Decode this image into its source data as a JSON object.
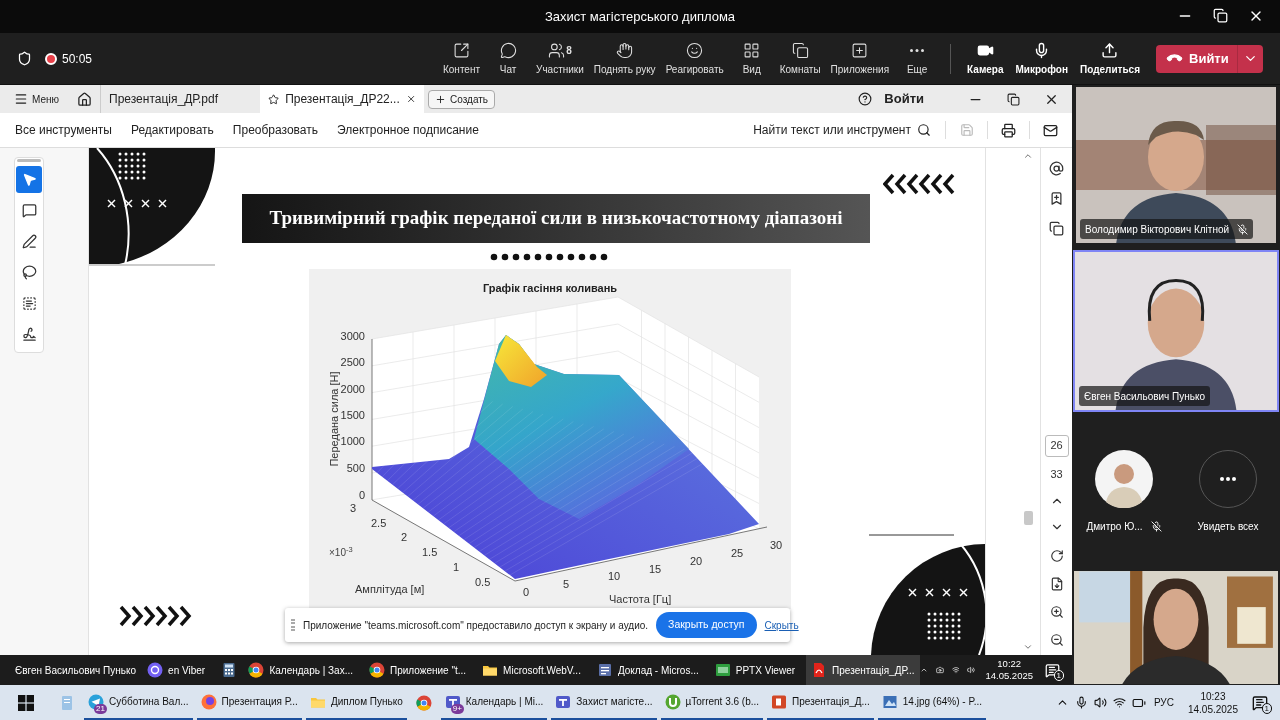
{
  "window": {
    "title": "Захист магістерського диплома"
  },
  "meeting": {
    "timer": "50:05",
    "recording": true,
    "actions": [
      {
        "label": "Контент"
      },
      {
        "label": "Чат"
      },
      {
        "label": "Участники",
        "count": "8"
      },
      {
        "label": "Поднять руку"
      },
      {
        "label": "Реагировать"
      },
      {
        "label": "Вид"
      },
      {
        "label": "Комнаты"
      },
      {
        "label": "Приложения"
      },
      {
        "label": "Еще"
      }
    ],
    "devices": [
      {
        "label": "Камера"
      },
      {
        "label": "Микрофон"
      },
      {
        "label": "Поделиться"
      }
    ],
    "leave_button": "Вийти"
  },
  "reader": {
    "menu_button": "Меню",
    "tabs": [
      {
        "label": "Презентація_ДР.pdf",
        "selected": false
      },
      {
        "label": "Презентація_ДР22...",
        "selected": true
      }
    ],
    "create_button": "Создать",
    "sign_in": "Войти",
    "menu": [
      "Все инструменты",
      "Редактировать",
      "Преобразовать",
      "Электронное подписание"
    ],
    "search": "Найти текст или инструмент",
    "tools": [
      {
        "selected": true
      },
      {
        "selected": false
      },
      {
        "selected": false
      },
      {
        "selected": false
      },
      {
        "selected": false
      },
      {
        "selected": false
      }
    ],
    "page": {
      "current": "26",
      "total": "33"
    }
  },
  "slide": {
    "title": "Тривимірний графік переданої сили в низькочастотному діапазоні",
    "chart": {
      "title": "Графік гасіння коливань",
      "zlabel": "Передана сила [Н]",
      "ylabel": "Амплітуда [м]",
      "xlabel": "Частота [Гц]",
      "yscale": "×10$^{-3}$",
      "zticks": [
        "3000",
        "2500",
        "2000",
        "1500",
        "1000",
        "500",
        "0"
      ],
      "yticks": [
        "3",
        "2.5",
        "2",
        "1.5",
        "1",
        "0.5"
      ],
      "xticks": [
        "0",
        "5",
        "10",
        "15",
        "20",
        "25",
        "30"
      ]
    }
  },
  "share_notice": {
    "text": "Приложение \"teams.microsoft.com\" предоставило доступ к экрану и аудио.",
    "button": "Закрыть доступ",
    "link": "Скрыть"
  },
  "participants": {
    "tiles": [
      {
        "name": "Володимир Вікторович Клітной",
        "muted": true,
        "speaking": false
      },
      {
        "name": "Євген Васильович Пунько",
        "muted": false,
        "speaking": true
      }
    ],
    "avatars": [
      {
        "name": "Дмитро Ю...",
        "muted": true
      }
    ],
    "see_all": "Увидеть всех"
  },
  "remote_taskbar": {
    "presenter": "Євген Васильович Пунько",
    "items": [
      {
        "kind": "window",
        "label": "en Viber"
      },
      {
        "kind": "pinned"
      },
      {
        "kind": "window",
        "label": "Календарь | Зах..."
      },
      {
        "kind": "window",
        "label": "Приложение \"t..."
      },
      {
        "kind": "window",
        "label": "Microsoft.WebV..."
      },
      {
        "kind": "window",
        "label": "Доклад - Micros..."
      },
      {
        "kind": "window",
        "label": "PPTX Viewer"
      },
      {
        "kind": "active",
        "label": "Презентація_ДР..."
      }
    ],
    "time": "10:22",
    "date": "14.05.2025",
    "notifications": "1"
  },
  "taskbar": {
    "items": [
      {
        "kind": "pinned"
      },
      {
        "kind": "window",
        "label": "Субботина Вал...",
        "badge": "21"
      },
      {
        "kind": "window",
        "label": "Презентация Р..."
      },
      {
        "kind": "window",
        "label": "Диплом Пунько"
      },
      {
        "kind": "pinned"
      },
      {
        "kind": "window",
        "label": "Календарь | Mi...",
        "badge": "9+"
      },
      {
        "kind": "window",
        "label": "Захист магісте..."
      },
      {
        "kind": "window",
        "label": "µTorrent 3.6  (b..."
      },
      {
        "kind": "window",
        "label": "Презентація_Д..."
      },
      {
        "kind": "window",
        "label": "14.jpg (64%) - P..."
      }
    ],
    "language": "РУС",
    "time": "10:23",
    "date": "14.05.2025",
    "notifications": "1"
  }
}
